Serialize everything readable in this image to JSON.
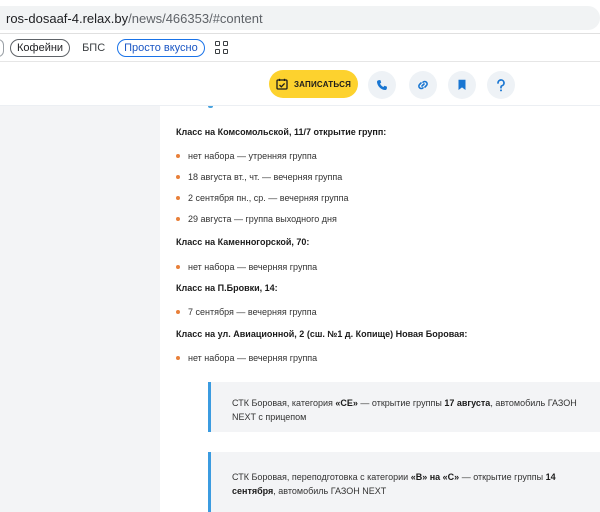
{
  "browser": {
    "url_host": "ros-dosaaf-4.relax.by",
    "url_path": "/news/466353/#content"
  },
  "bookmarks": [
    {
      "label": "Кофейни",
      "style": "outlined"
    },
    {
      "label": "БПС",
      "style": "plain"
    },
    {
      "label": "Просто вкусно",
      "style": "blue"
    }
  ],
  "header": {
    "signup_label": "ЗАПИСАТЬСЯ",
    "icons": [
      "phone-icon",
      "link-icon",
      "bookmark-icon",
      "help-icon"
    ]
  },
  "colors": {
    "accent_yellow": "#fdd22e",
    "accent_blue": "#1976d2",
    "bullet_orange": "#e8803a",
    "quote_bar": "#3b9be0"
  },
  "groups": [
    {
      "heading": "Класс на Комсомольской, 11/7 открытие групп:",
      "items": [
        "нет набора — утренняя группа",
        "18 августа вт., чт. — вечерняя группа",
        "2 сентября пн., ср. — вечерняя группа",
        "29 августа — группа выходного дня"
      ]
    },
    {
      "heading": "Класс на Каменногорской, 70:",
      "items": [
        "нет набора — вечерняя группа"
      ]
    },
    {
      "heading": "Класс на П.Бровки, 14:",
      "items": [
        "7 сентября — вечерняя группа"
      ]
    },
    {
      "heading": "Класс на ул. Авиационной, 2 (сш. №1 д. Копище) Новая Боровая:",
      "items": [
        "нет набора — вечерняя группа"
      ]
    }
  ],
  "quotes": [
    {
      "t1": "СТК Боровая, категория ",
      "b1": "«СЕ»",
      "t2": " — открытие группы ",
      "b2": "17 августа",
      "t3": ", автомобиль ГАЗОН NEXT с прицепом"
    },
    {
      "t1": "СТК Боровая, переподготовка с категории ",
      "b1": "«В» на «С»",
      "t2": " — открытие группы ",
      "b2": "14 сентября",
      "t3": ", автомобиль ГАЗОН NEXT"
    }
  ]
}
